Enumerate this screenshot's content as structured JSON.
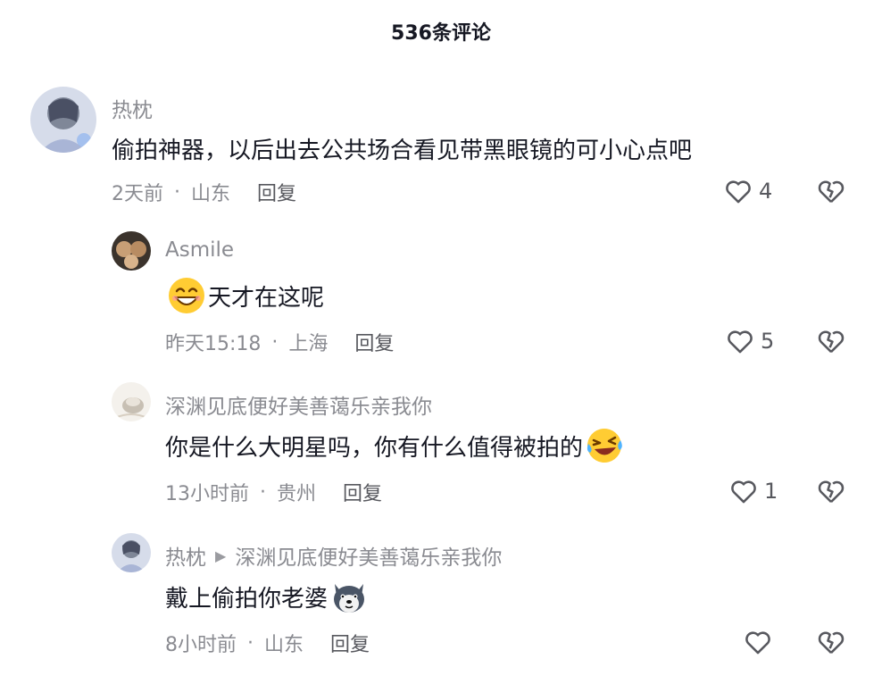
{
  "header": {
    "title": "536条评论"
  },
  "comments": [
    {
      "user": "热枕",
      "text": "偷拍神器，以后出去公共场合看见带黑眼镜的可小心点吧",
      "time": "2天前",
      "location": "山东",
      "reply_label": "回复",
      "likes": "4"
    },
    {
      "user": "Asmile",
      "text": "天才在这呢",
      "time": "昨天15:18",
      "location": "上海",
      "reply_label": "回复",
      "likes": "5",
      "emoji": "grin-emoji"
    },
    {
      "user": "深渊见底便好美善蔼乐亲我你",
      "text": "你是什么大明星吗，你有什么值得被拍的",
      "time": "13小时前",
      "location": "贵州",
      "reply_label": "回复",
      "likes": "1",
      "emoji": "laugh-cry-emoji"
    },
    {
      "user": "热枕",
      "reply_to": "深渊见底便好美善蔼乐亲我你",
      "text": "戴上偷拍你老婆",
      "time": "8小时前",
      "location": "山东",
      "reply_label": "回复",
      "likes": "",
      "emoji": "dog-face-emoji"
    }
  ],
  "colors": {
    "secondary_text": "#8a8b91",
    "primary_text": "#161823"
  }
}
